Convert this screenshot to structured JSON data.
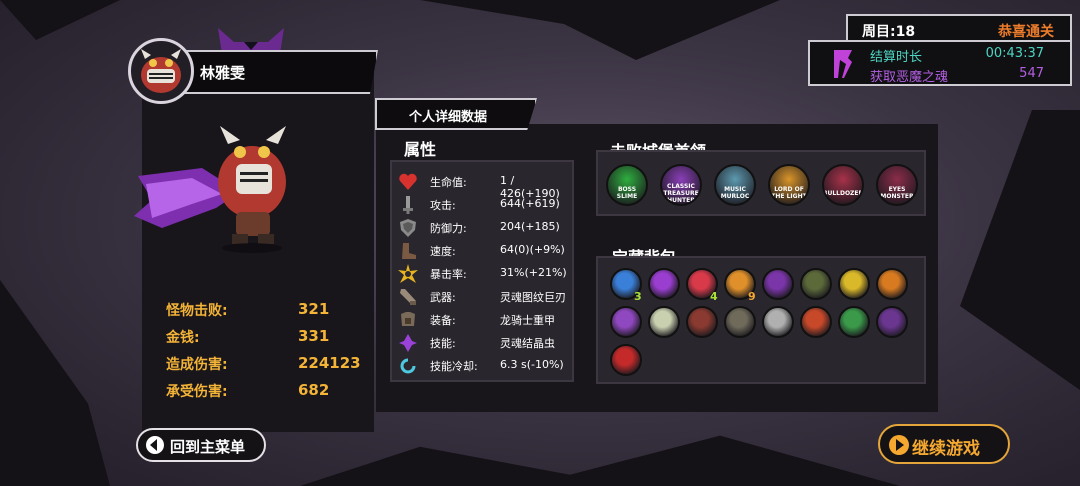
{
  "player": {
    "name": "林雅雯",
    "stats": [
      {
        "label": "怪物击败:",
        "value": "321"
      },
      {
        "label": "金钱:",
        "value": "331"
      },
      {
        "label": "造成伤害:",
        "value": "224123"
      },
      {
        "label": "承受伤害:",
        "value": "682"
      }
    ]
  },
  "run": {
    "cycle_label": "周目:18",
    "status": "恭喜通关",
    "time_label": "结算时长",
    "time_value": "00:43:37",
    "souls_label": "获取恶魔之魂",
    "souls_value": "547"
  },
  "detail": {
    "tab_label": "个人详细数据",
    "attributes_title": "属性",
    "attributes": [
      {
        "icon": "heart-icon",
        "label": "生命值:",
        "value": "1 / 426(+190)"
      },
      {
        "icon": "sword-icon",
        "label": "攻击:",
        "value": "644(+619)"
      },
      {
        "icon": "shield-icon",
        "label": "防御力:",
        "value": "204(+185)"
      },
      {
        "icon": "boot-icon",
        "label": "速度:",
        "value": "64(0)(+9%)"
      },
      {
        "icon": "burst-icon",
        "label": "暴击率:",
        "value": "31%(+21%)"
      },
      {
        "icon": "weapon-icon",
        "label": "武器:",
        "value": "灵魂图纹巨刃"
      },
      {
        "icon": "armor-icon",
        "label": "装备:",
        "value": "龙骑士重甲"
      },
      {
        "icon": "skill-icon",
        "label": "技能:",
        "value": "灵魂结晶虫"
      },
      {
        "icon": "cooldown-icon",
        "label": "技能冷却:",
        "value": "6.3 s(-10%)"
      }
    ],
    "bosses_title": "击败城堡首领",
    "bosses": [
      {
        "label": "BOSS SLIME",
        "color": "#2fae3f"
      },
      {
        "label": "CLASSIC TREASURE HUNTER",
        "color": "#8a3fb8"
      },
      {
        "label": "MUSIC MURLOC",
        "color": "#5d9ab0"
      },
      {
        "label": "LORD OF THE LIGHT",
        "color": "#d9952a"
      },
      {
        "label": "BULLDOZER",
        "color": "#a8324a"
      },
      {
        "label": "EYES MONSTER",
        "color": "#8c2d4a"
      }
    ],
    "bag_title": "宝藏背包",
    "items": [
      {
        "icon": "blue-crystal-icon",
        "color": "#3a7fd8",
        "count": "3"
      },
      {
        "icon": "purple-crystal-icon",
        "color": "#9a3ed0",
        "count": ""
      },
      {
        "icon": "red-crystal-icon",
        "color": "#d83a4a",
        "count": "4"
      },
      {
        "icon": "fire-crystal-icon",
        "color": "#e0902a",
        "count": "9"
      },
      {
        "icon": "purple-beast-icon",
        "color": "#7a35a8",
        "count": ""
      },
      {
        "icon": "green-bag-icon",
        "color": "#5c6a3a",
        "count": ""
      },
      {
        "icon": "gold-claw-icon",
        "color": "#d9b82a",
        "count": ""
      },
      {
        "icon": "sun-emblem-icon",
        "color": "#d77a20",
        "count": ""
      },
      {
        "icon": "purple-horn-icon",
        "color": "#9048c0",
        "count": ""
      },
      {
        "icon": "flower-icon",
        "color": "#c9d0b0",
        "count": ""
      },
      {
        "icon": "dark-totem-icon",
        "color": "#8a3a30",
        "count": ""
      },
      {
        "icon": "stone-ring-icon",
        "color": "#6f6a5a",
        "count": ""
      },
      {
        "icon": "helmet-icon",
        "color": "#b0b0b0",
        "count": ""
      },
      {
        "icon": "fire-rune-icon",
        "color": "#c8492a",
        "count": ""
      },
      {
        "icon": "green-serpent-icon",
        "color": "#3a9a4a",
        "count": ""
      },
      {
        "icon": "purple-wing-icon",
        "color": "#6a3690",
        "count": ""
      },
      {
        "icon": "red-dragon-icon",
        "color": "#c42a2a",
        "count": ""
      }
    ]
  },
  "buttons": {
    "main_menu": "回到主菜单",
    "continue": "继续游戏"
  },
  "colors": {
    "gold": "#f3b437",
    "orange": "#ec7c2b",
    "teal": "#4ed4c2",
    "violet": "#b35fe3",
    "count_green": "#a8e03a",
    "count_orange": "#f5a830"
  }
}
